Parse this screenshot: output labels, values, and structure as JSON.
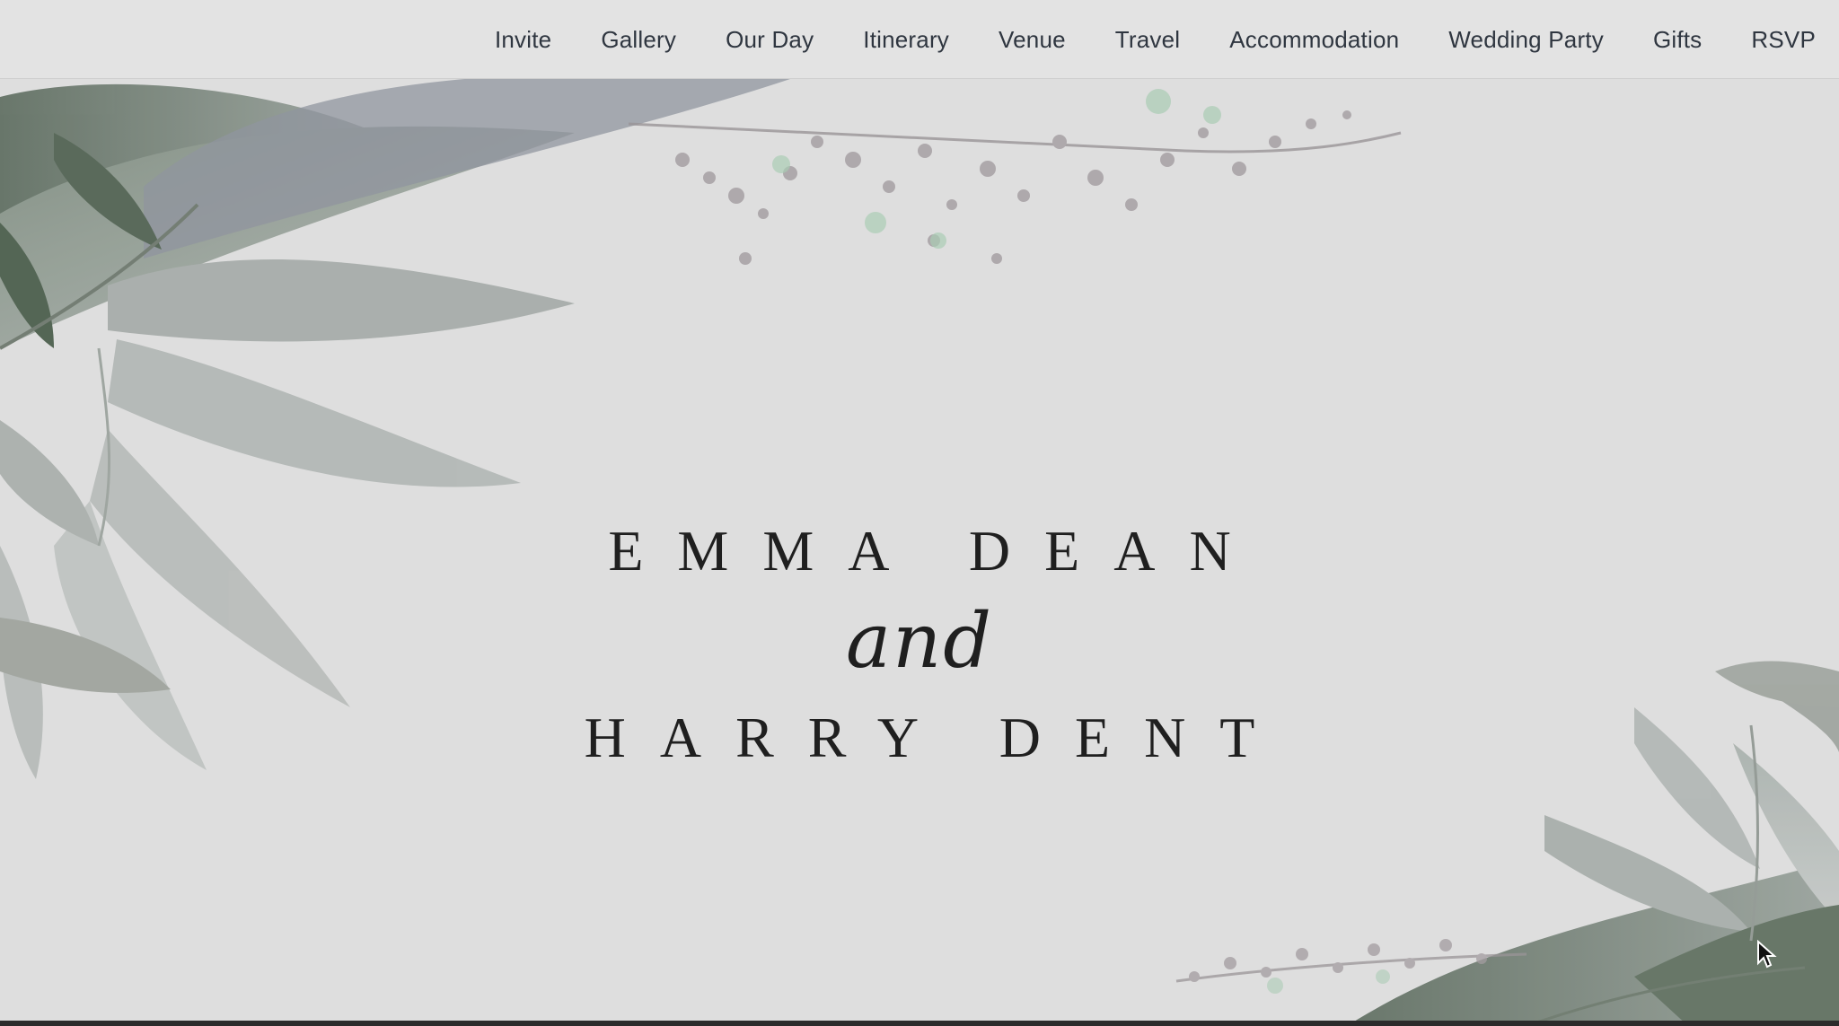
{
  "nav": {
    "items": [
      "Invite",
      "Gallery",
      "Our Day",
      "Itinerary",
      "Venue",
      "Travel",
      "Accommodation",
      "Wedding Party",
      "Gifts",
      "RSVP"
    ]
  },
  "hero": {
    "name_one": "EMMA DEAN",
    "connector": "and",
    "name_two": "HARRY DENT"
  },
  "colors": {
    "background": "#dedede",
    "nav_text": "#2f3640",
    "title_text": "#1f1f1f",
    "leaf_dark": "#6f7f6d",
    "leaf_light": "#a9b0ad"
  },
  "icons": {
    "cursor": "mouse-pointer-icon"
  }
}
